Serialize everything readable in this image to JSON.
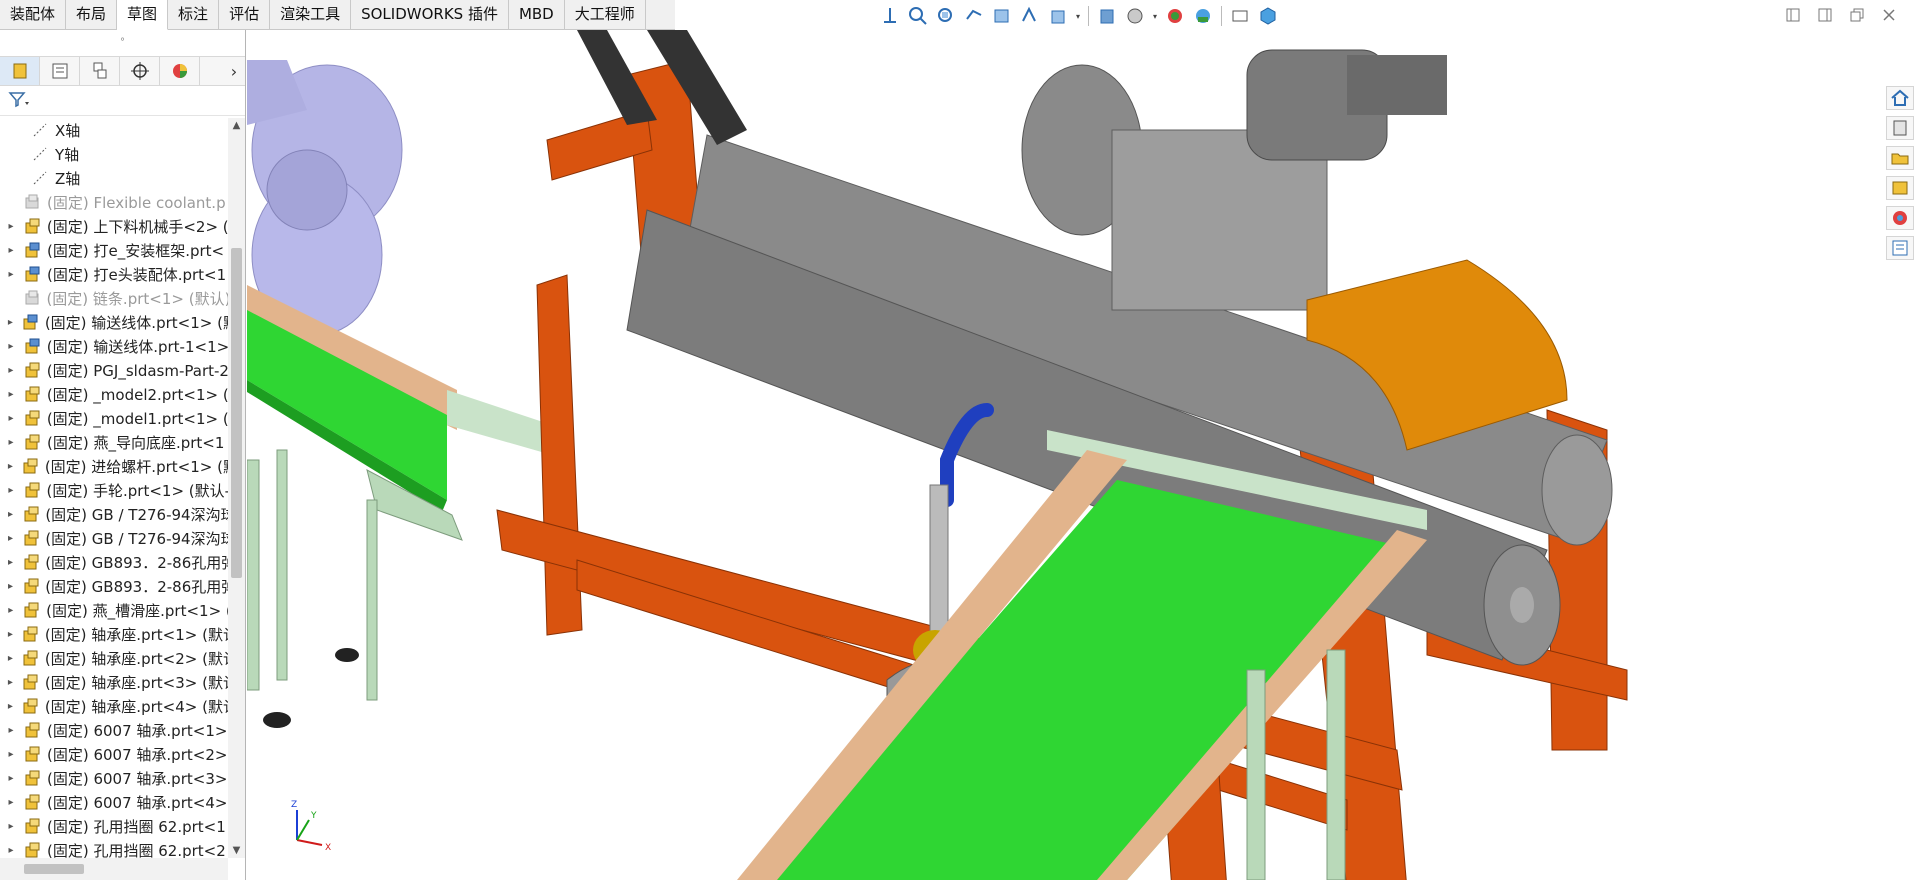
{
  "tabs": [
    {
      "label": "装配体",
      "active": false
    },
    {
      "label": "布局",
      "active": false
    },
    {
      "label": "草图",
      "active": true
    },
    {
      "label": "标注",
      "active": false
    },
    {
      "label": "评估",
      "active": false
    },
    {
      "label": "渲染工具",
      "active": false
    },
    {
      "label": "SOLIDWORKS 插件",
      "active": false
    },
    {
      "label": "MBD",
      "active": false
    },
    {
      "label": "大工程师",
      "active": false
    }
  ],
  "hud_icons": [
    "view-orientation-icon",
    "zoom-to-fit-icon",
    "zoom-area-icon",
    "previous-view-icon",
    "section-view-icon",
    "dynamic-annotation-icon",
    "view-cube-icon",
    "display-style-icon",
    "hide-show-icon",
    "edit-appearance-icon",
    "scene-icon",
    "view-settings-icon",
    "display-3d-icon"
  ],
  "panel_tabs": [
    "feature-manager-icon",
    "property-manager-icon",
    "configuration-manager-icon",
    "dimxpert-icon",
    "display-manager-icon"
  ],
  "tree": [
    {
      "label": "X轴",
      "type": "axis",
      "expand": false,
      "dim": false
    },
    {
      "label": "Y轴",
      "type": "axis",
      "expand": false,
      "dim": false
    },
    {
      "label": "Z轴",
      "type": "axis",
      "expand": false,
      "dim": false
    },
    {
      "label": "(固定) Flexible coolant.p",
      "type": "asm-gray",
      "expand": false,
      "dim": true
    },
    {
      "label": "(固定) 上下料机械手<2> (",
      "type": "part",
      "expand": true,
      "dim": false
    },
    {
      "label": "(固定) 打e_安装框架.prt<",
      "type": "asm",
      "expand": true,
      "dim": false
    },
    {
      "label": "(固定) 打e头装配体.prt<1",
      "type": "asm",
      "expand": true,
      "dim": false
    },
    {
      "label": "(固定) 链条.prt<1> (默认)",
      "type": "asm-gray",
      "expand": false,
      "dim": true
    },
    {
      "label": "(固定) 输送线体.prt<1> (默",
      "type": "asm",
      "expand": true,
      "dim": false
    },
    {
      "label": "(固定) 输送线体.prt-1<1>",
      "type": "asm",
      "expand": true,
      "dim": false
    },
    {
      "label": "(固定) PGJ_sldasm-Part-2",
      "type": "part",
      "expand": true,
      "dim": false
    },
    {
      "label": "(固定) _model2.prt<1> (",
      "type": "part",
      "expand": true,
      "dim": false
    },
    {
      "label": "(固定) _model1.prt<1> (",
      "type": "part",
      "expand": true,
      "dim": false
    },
    {
      "label": "(固定) 燕_导向底座.prt<1",
      "type": "part",
      "expand": true,
      "dim": false
    },
    {
      "label": "(固定) 进给螺杆.prt<1> (默",
      "type": "part",
      "expand": true,
      "dim": false
    },
    {
      "label": "(固定) 手轮.prt<1> (默认-",
      "type": "part",
      "expand": true,
      "dim": false
    },
    {
      "label": "(固定) GB / T276-94深沟球",
      "type": "part",
      "expand": true,
      "dim": false
    },
    {
      "label": "(固定) GB / T276-94深沟球",
      "type": "part",
      "expand": true,
      "dim": false
    },
    {
      "label": "(固定) GB893．2-86孔用弹",
      "type": "part",
      "expand": true,
      "dim": false
    },
    {
      "label": "(固定) GB893．2-86孔用弹",
      "type": "part",
      "expand": true,
      "dim": false
    },
    {
      "label": "(固定) 燕_槽滑座.prt<1> (",
      "type": "part",
      "expand": true,
      "dim": false
    },
    {
      "label": "(固定) 轴承座.prt<1> (默认",
      "type": "part",
      "expand": true,
      "dim": false
    },
    {
      "label": "(固定) 轴承座.prt<2> (默认",
      "type": "part",
      "expand": true,
      "dim": false
    },
    {
      "label": "(固定) 轴承座.prt<3> (默认",
      "type": "part",
      "expand": true,
      "dim": false
    },
    {
      "label": "(固定) 轴承座.prt<4> (默认",
      "type": "part",
      "expand": true,
      "dim": false
    },
    {
      "label": "(固定) 6007 轴承.prt<1>",
      "type": "part",
      "expand": true,
      "dim": false
    },
    {
      "label": "(固定) 6007 轴承.prt<2>",
      "type": "part",
      "expand": true,
      "dim": false
    },
    {
      "label": "(固定) 6007 轴承.prt<3>",
      "type": "part",
      "expand": true,
      "dim": false
    },
    {
      "label": "(固定) 6007 轴承.prt<4>",
      "type": "part",
      "expand": true,
      "dim": false
    },
    {
      "label": "(固定) 孔用挡圈 62.prt<1",
      "type": "part",
      "expand": true,
      "dim": false
    },
    {
      "label": "(固定) 孔用挡圈 62.prt<2",
      "type": "part",
      "expand": true,
      "dim": false
    }
  ],
  "triad": {
    "x": "X",
    "y": "Y",
    "z": "Z"
  },
  "taskpane_icons": [
    "home-icon",
    "design-library-icon",
    "file-explorer-icon",
    "view-palette-icon",
    "appearances-icon",
    "custom-properties-icon"
  ],
  "colors": {
    "frame": "#d9530f",
    "belt": "#2fd633",
    "roller": "#8a8a8a",
    "cover": "#e08a0a",
    "conveyor_frame": "#b9d9b9",
    "robot": "#b5b5e6"
  }
}
